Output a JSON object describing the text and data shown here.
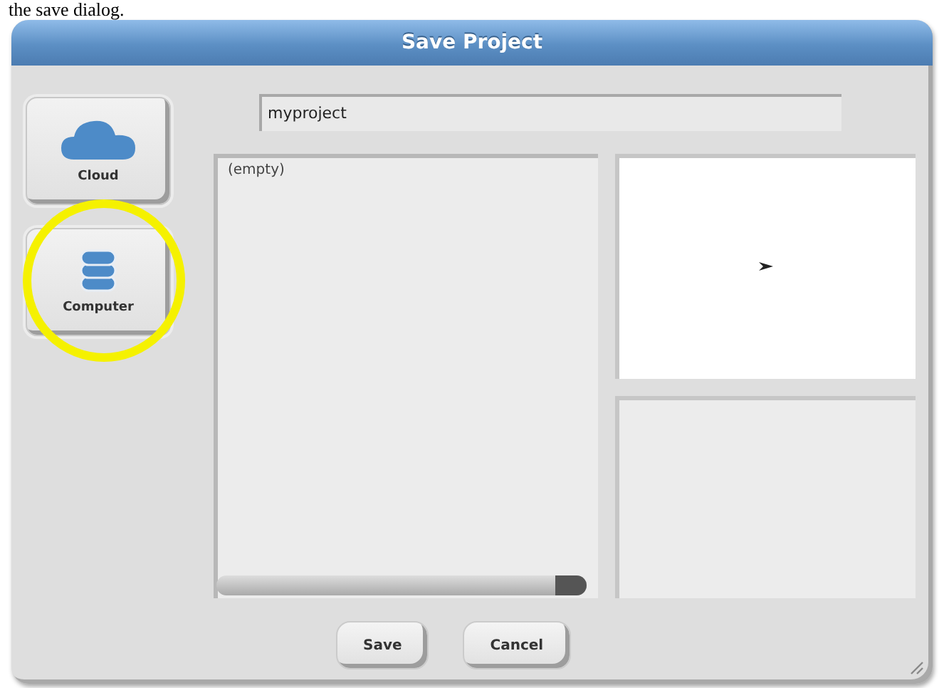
{
  "caption": "the save dialog.",
  "dialog": {
    "title": "Save Project",
    "sources": [
      {
        "label": "Cloud",
        "kind": "cloud",
        "highlighted": false
      },
      {
        "label": "Computer",
        "kind": "computer",
        "highlighted": true
      }
    ],
    "name_field": {
      "value": "myproject"
    },
    "project_list": {
      "items": [
        "(empty)"
      ]
    },
    "buttons": [
      "Save",
      "Cancel"
    ]
  }
}
